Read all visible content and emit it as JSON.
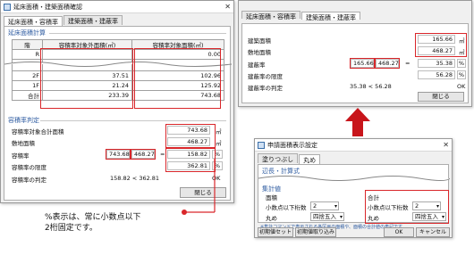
{
  "win1": {
    "title": "延床面積・建築面積確認",
    "tabs": [
      "延床面積・容積率",
      "建築面積・建蔽率"
    ],
    "group1": "延床面積計算",
    "table": {
      "headers": [
        "階",
        "容積率対象外面積(㎡)",
        "容積率対象面積(㎡)"
      ],
      "rows": [
        [
          "R",
          "",
          "0.00"
        ],
        [
          "",
          "",
          ""
        ],
        [
          "2F",
          "37.51",
          "102.96"
        ],
        [
          "1F",
          "21.24",
          "125.92"
        ],
        [
          "合計",
          "233.39",
          "743.68"
        ]
      ]
    },
    "group2": "容積率判定",
    "fields": [
      {
        "label": "容積率対象合計面積",
        "value": "743.68",
        "unit": "㎡"
      },
      {
        "label": "敷地面積",
        "value": "468.27",
        "unit": "㎡"
      },
      {
        "label": "容積率",
        "calc1": "743.68",
        "calc2": "468.27",
        "eq": "=",
        "value": "158.82",
        "unit": "%"
      },
      {
        "label": "容積率の限度",
        "value": "362.81",
        "unit": "%"
      },
      {
        "label": "容積率の判定",
        "judge": "158.82 < 362.81",
        "result": "OK"
      }
    ],
    "close": "閉じる"
  },
  "win2": {
    "tabs": [
      "延床面積・容積率",
      "建築面積・建蔽率"
    ],
    "fields": [
      {
        "label": "建築面積",
        "value": "165.66",
        "unit": "㎡"
      },
      {
        "label": "敷地面積",
        "value": "468.27",
        "unit": "㎡"
      },
      {
        "label": "建蔽率",
        "calc1": "165.66",
        "calc2": "468.27",
        "eq": "=",
        "value": "35.38",
        "unit": "%"
      },
      {
        "label": "建蔽率の限度",
        "value": "56.28",
        "unit": "%"
      },
      {
        "label": "建蔽率の判定",
        "judge": "35.38 < 56.28",
        "result": "OK"
      }
    ],
    "close": "閉じる"
  },
  "win3": {
    "title": "申請面積表示設定",
    "tabs": [
      "塗りつぶし",
      "丸め"
    ],
    "group1": "辺長・計算式",
    "group2": "集計値",
    "area": {
      "title": "面積",
      "digits_label": "小数点以下桁数",
      "digits": "2",
      "round_label": "丸め",
      "round": "四捨五入"
    },
    "total": {
      "title": "合計",
      "digits_label": "小数点以下桁数",
      "digits": "2",
      "round_label": "丸め",
      "round": "四捨五入"
    },
    "note": "※集計コマンドで表示される各区画の面積や、面積の合計値の表記です",
    "buttons": [
      "初期値セット",
      "初期値取り込み",
      "OK",
      "キャンセル"
    ]
  },
  "callout": "%表示は、常に小数点以下\n2桁固定です。",
  "colors": {
    "highlight": "#d9262a",
    "arrow": "#c8151b",
    "group": "#2c5aa0"
  }
}
